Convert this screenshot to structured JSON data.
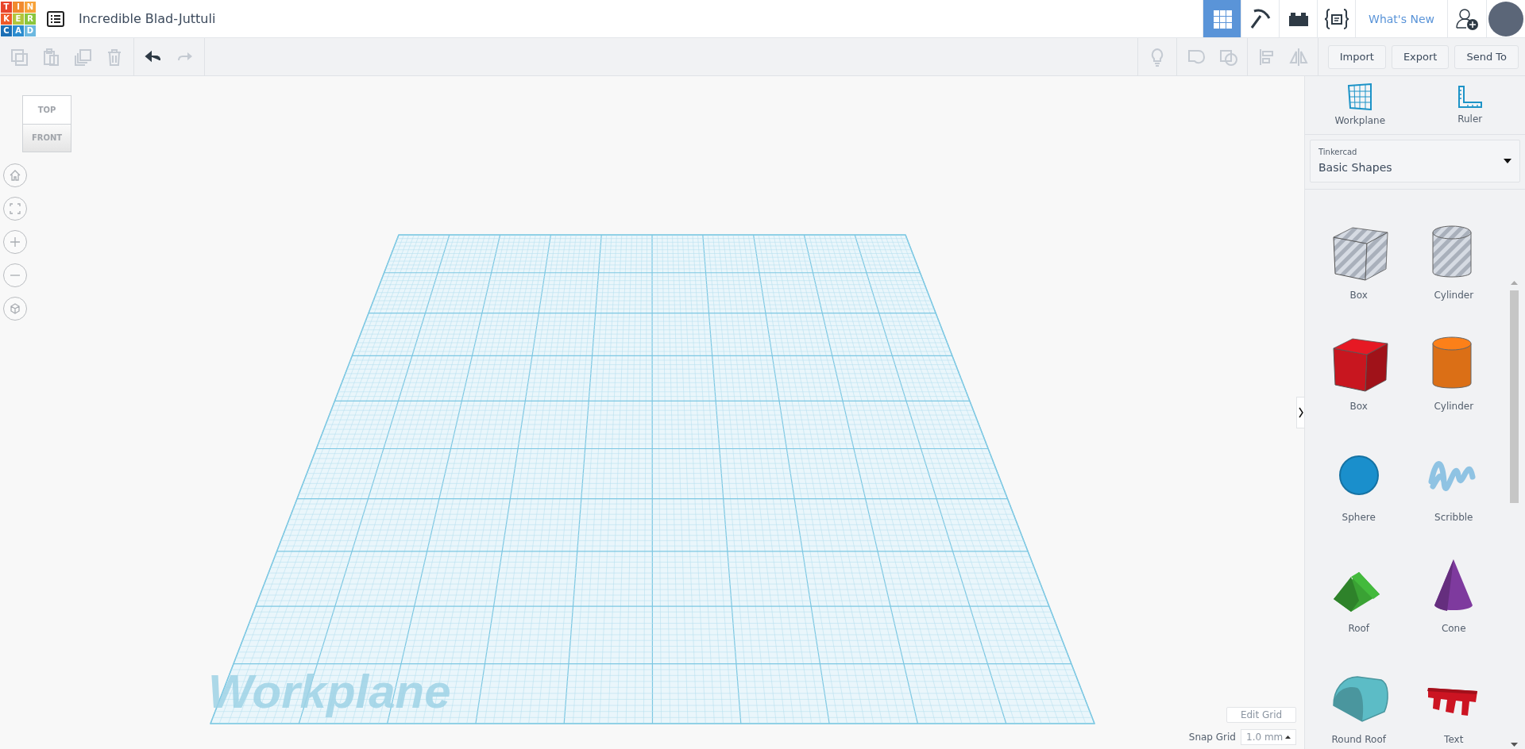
{
  "logo": {
    "tiles": [
      {
        "letter": "T",
        "color": "#e8452c"
      },
      {
        "letter": "I",
        "color": "#f18a2e"
      },
      {
        "letter": "N",
        "color": "#f7a23a"
      },
      {
        "letter": "K",
        "color": "#f05a28"
      },
      {
        "letter": "E",
        "color": "#b2c53c"
      },
      {
        "letter": "R",
        "color": "#8cc63e"
      },
      {
        "letter": "C",
        "color": "#1c6fb5"
      },
      {
        "letter": "A",
        "color": "#2b8ccf"
      },
      {
        "letter": "D",
        "color": "#6cb8e0"
      }
    ]
  },
  "design_title": "Incredible Blad-Juttuli",
  "nav_tabs": [
    {
      "kind": "grid",
      "selected": true
    },
    {
      "kind": "pickaxe",
      "selected": false
    },
    {
      "kind": "bricks",
      "selected": false
    },
    {
      "kind": "codeblocks",
      "selected": false
    }
  ],
  "whats_new": "What's New",
  "edit_tools": [
    {
      "kind": "copy",
      "disabled": true
    },
    {
      "kind": "paste",
      "disabled": true
    },
    {
      "kind": "duplicate",
      "disabled": true
    },
    {
      "kind": "delete",
      "disabled": true
    }
  ],
  "history_tools": [
    {
      "kind": "undo",
      "disabled": false
    },
    {
      "kind": "redo",
      "disabled": true
    }
  ],
  "shape_tools": [
    {
      "kind": "bulb",
      "disabled": true
    },
    {
      "kind": "group",
      "disabled": true
    },
    {
      "kind": "ungroup",
      "disabled": true
    },
    {
      "kind": "align",
      "disabled": true
    },
    {
      "kind": "mirror",
      "disabled": true
    }
  ],
  "action_buttons": [
    "Import",
    "Export",
    "Send To"
  ],
  "view_cube": {
    "top": "TOP",
    "front": "FRONT"
  },
  "view_controls": [
    {
      "kind": "home"
    },
    {
      "kind": "fit"
    },
    {
      "kind": "zoom-in"
    },
    {
      "kind": "zoom-out"
    },
    {
      "kind": "perspective"
    }
  ],
  "workplane": {
    "label": "Workplane"
  },
  "grid": {
    "edit_button": "Edit Grid",
    "snap_label": "Snap Grid",
    "snap_value": "1.0 mm"
  },
  "panel_tools": [
    {
      "kind": "workplane",
      "label": "Workplane"
    },
    {
      "kind": "ruler",
      "label": "Ruler"
    }
  ],
  "library": {
    "source": "Tinkercad",
    "value": "Basic Shapes"
  },
  "shapes": [
    {
      "kind": "box",
      "label": "Box",
      "color": "#a9b0bb",
      "hole": true
    },
    {
      "kind": "cylinder",
      "label": "Cylinder",
      "color": "#a9b0bb",
      "hole": true
    },
    {
      "kind": "box",
      "label": "Box",
      "color": "#c8161f",
      "hole": false
    },
    {
      "kind": "cylinder",
      "label": "Cylinder",
      "color": "#db6f16",
      "hole": false
    },
    {
      "kind": "sphere",
      "label": "Sphere",
      "color": "#1a8fcc",
      "hole": false
    },
    {
      "kind": "scribble",
      "label": "Scribble",
      "color": "#8fc3e3",
      "hole": false
    },
    {
      "kind": "roof",
      "label": "Roof",
      "color": "#3aa234",
      "hole": false
    },
    {
      "kind": "cone",
      "label": "Cone",
      "color": "#7e3a9e",
      "hole": false
    },
    {
      "kind": "round-roof",
      "label": "Round Roof",
      "color": "#5cbcc6",
      "hole": false
    },
    {
      "kind": "text",
      "label": "Text",
      "color": "#cc1422",
      "hole": false
    }
  ]
}
